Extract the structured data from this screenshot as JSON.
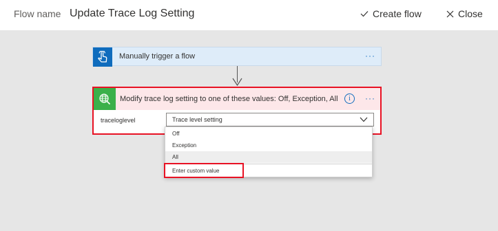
{
  "header": {
    "flow_name_label": "Flow name",
    "flow_title": "Update Trace Log Setting",
    "create_flow_label": "Create flow",
    "close_label": "Close"
  },
  "trigger": {
    "label": "Manually trigger a flow",
    "more": "···",
    "icon": "hand-pointer-icon"
  },
  "action": {
    "title": "Modify trace log setting to one of these values: Off, Exception, All",
    "info": "i",
    "more": "···",
    "icon": "globe-search-icon",
    "param_label": "traceloglevel",
    "select_value": "Trace level setting"
  },
  "dropdown": {
    "options": [
      "Off",
      "Exception",
      "All"
    ],
    "selected_index": 2,
    "custom_value_label": "Enter custom value"
  },
  "colors": {
    "trigger_bg": "#deecf9",
    "trigger_icon": "#0f6cbd",
    "action_header_bg": "#fde7e9",
    "action_icon": "#3bb04a",
    "highlight_red": "#e81123"
  }
}
